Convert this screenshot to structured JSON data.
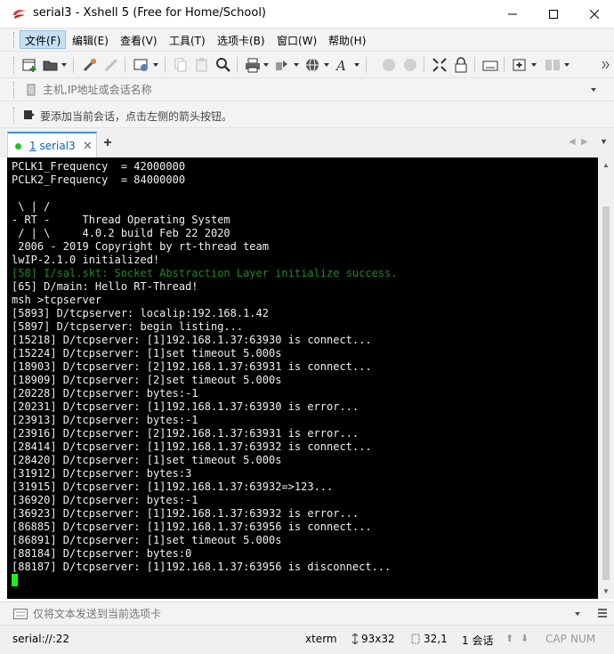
{
  "window": {
    "title": "serial3 - Xshell 5 (Free for Home/School)",
    "icon": "xshell-logo-icon",
    "controls": [
      "minimize-icon",
      "maximize-icon",
      "close-icon"
    ]
  },
  "menubar": {
    "items": [
      {
        "label": "文件(F)",
        "active": true
      },
      {
        "label": "编辑(E)"
      },
      {
        "label": "查看(V)"
      },
      {
        "label": "工具(T)"
      },
      {
        "label": "选项卡(B)"
      },
      {
        "label": "窗口(W)"
      },
      {
        "label": "帮助(H)"
      }
    ]
  },
  "toolbar": {
    "icons": [
      "new-session-icon",
      "open-folder-icon",
      "connect-icon",
      "disconnect-icon",
      "properties-icon",
      "copy-icon",
      "paste-icon",
      "find-icon",
      "print-icon",
      "transfer-icon",
      "globe-icon",
      "font-icon",
      "script-icon",
      "record-icon",
      "fullscreen-icon",
      "lock-icon",
      "keyboard-icon",
      "new-tab-icon",
      "layout-icon"
    ]
  },
  "addressbar": {
    "placeholder": "主机,IP地址或会话名称"
  },
  "hintbar": {
    "text": "要添加当前会话，点击左侧的箭头按钮。"
  },
  "tabs": [
    {
      "number": "1",
      "label": "serial3",
      "active": true,
      "status_color": "#22c022"
    }
  ],
  "terminal": {
    "background": "#000000",
    "foreground": "#f0f0f0",
    "lines": [
      {
        "text": "PCLK1_Frequency  = 42000000"
      },
      {
        "text": "PCLK2_Frequency  = 84000000"
      },
      {
        "text": ""
      },
      {
        "text": " \\ | /"
      },
      {
        "text": "- RT -     Thread Operating System"
      },
      {
        "text": " / | \\     4.0.2 build Feb 22 2020"
      },
      {
        "text": " 2006 - 2019 Copyright by rt-thread team"
      },
      {
        "text": "lwIP-2.1.0 initialized!"
      },
      {
        "text": "[58] I/sal.skt: Socket Abstraction Layer initialize success.",
        "color": "green"
      },
      {
        "text": "[65] D/main: Hello RT-Thread!"
      },
      {
        "text": "msh >tcpserver"
      },
      {
        "text": "[5893] D/tcpserver: localip:192.168.1.42"
      },
      {
        "text": "[5897] D/tcpserver: begin listing..."
      },
      {
        "text": "[15218] D/tcpserver: [1]192.168.1.37:63930 is connect..."
      },
      {
        "text": "[15224] D/tcpserver: [1]set timeout 5.000s"
      },
      {
        "text": "[18903] D/tcpserver: [2]192.168.1.37:63931 is connect..."
      },
      {
        "text": "[18909] D/tcpserver: [2]set timeout 5.000s"
      },
      {
        "text": "[20228] D/tcpserver: bytes:-1"
      },
      {
        "text": "[20231] D/tcpserver: [1]192.168.1.37:63930 is error..."
      },
      {
        "text": "[23913] D/tcpserver: bytes:-1"
      },
      {
        "text": "[23916] D/tcpserver: [2]192.168.1.37:63931 is error..."
      },
      {
        "text": "[28414] D/tcpserver: [1]192.168.1.37:63932 is connect..."
      },
      {
        "text": "[28420] D/tcpserver: [1]set timeout 5.000s"
      },
      {
        "text": "[31912] D/tcpserver: bytes:3"
      },
      {
        "text": "[31915] D/tcpserver: [1]192.168.1.37:63932=>123..."
      },
      {
        "text": "[36920] D/tcpserver: bytes:-1"
      },
      {
        "text": "[36923] D/tcpserver: [1]192.168.1.37:63932 is error..."
      },
      {
        "text": "[86885] D/tcpserver: [1]192.168.1.37:63956 is connect..."
      },
      {
        "text": "[86891] D/tcpserver: [1]set timeout 5.000s"
      },
      {
        "text": "[88184] D/tcpserver: bytes:0"
      },
      {
        "text": "[88187] D/tcpserver: [1]192.168.1.37:63956 is disconnect..."
      }
    ],
    "cursor_color": "#1cf01c"
  },
  "sendbar": {
    "placeholder": "仅将文本发送到当前选项卡"
  },
  "statusbar": {
    "connection": "serial://:22",
    "terminal_type": "xterm",
    "size": "93x32",
    "cursor_pos": "32,1",
    "sessions": "1 会话",
    "caps": "CAP",
    "num": "NUM"
  }
}
